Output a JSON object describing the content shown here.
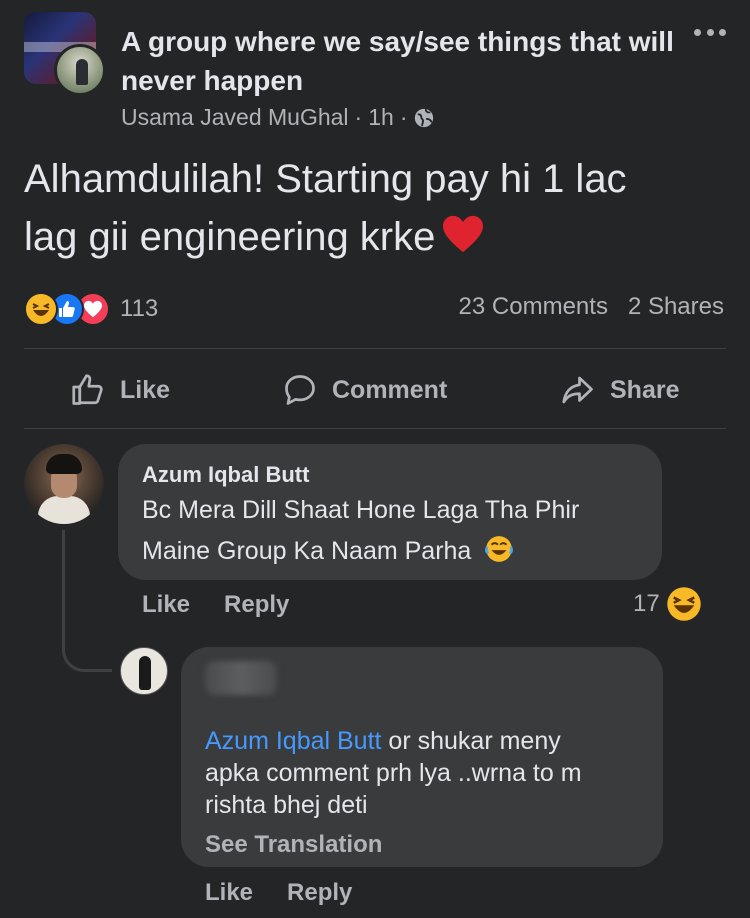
{
  "post": {
    "group_name": "A group where we say/see things that will never happen",
    "author": "Usama Javed MuGhal",
    "time": "1h",
    "separator": "·",
    "text_line1": "Alhamdulilah! Starting pay hi 1 lac",
    "text_line2": "lag gii engineering krke",
    "reaction_count": "113",
    "comments_count": "23 Comments",
    "shares_count": "2 Shares"
  },
  "actions": {
    "like": "Like",
    "comment": "Comment",
    "share": "Share"
  },
  "comments": [
    {
      "author": "Azum Iqbal Butt",
      "text_line1": "Bc Mera Dill Shaat Hone Laga Tha Phir",
      "text_line2": "Maine Group Ka Naam Parha",
      "like_label": "Like",
      "reply_label": "Reply",
      "reaction_count": "17"
    },
    {
      "mention": "Azum Iqbal Butt",
      "text_line1_rest": " or shukar meny",
      "text_line2": "apka comment prh lya ..wrna to m",
      "text_line3": "rishta bhej deti",
      "see_translation": "See Translation",
      "like_label": "Like",
      "reply_label": "Reply"
    }
  ],
  "colors": {
    "background": "#242526",
    "bubble": "#3a3b3c",
    "primary_text": "#e4e6eb",
    "secondary_text": "#b0b3b8",
    "mention": "#4599ff",
    "like_blue": "#1877f2",
    "love_red": "#f33e58",
    "haha_yellow": "#f7b928"
  },
  "icons": [
    "more-icon",
    "globe-icon",
    "heart-emoji",
    "haha-reaction-icon",
    "like-reaction-icon",
    "love-reaction-icon",
    "thumbs-up-icon",
    "comment-icon",
    "share-icon"
  ]
}
